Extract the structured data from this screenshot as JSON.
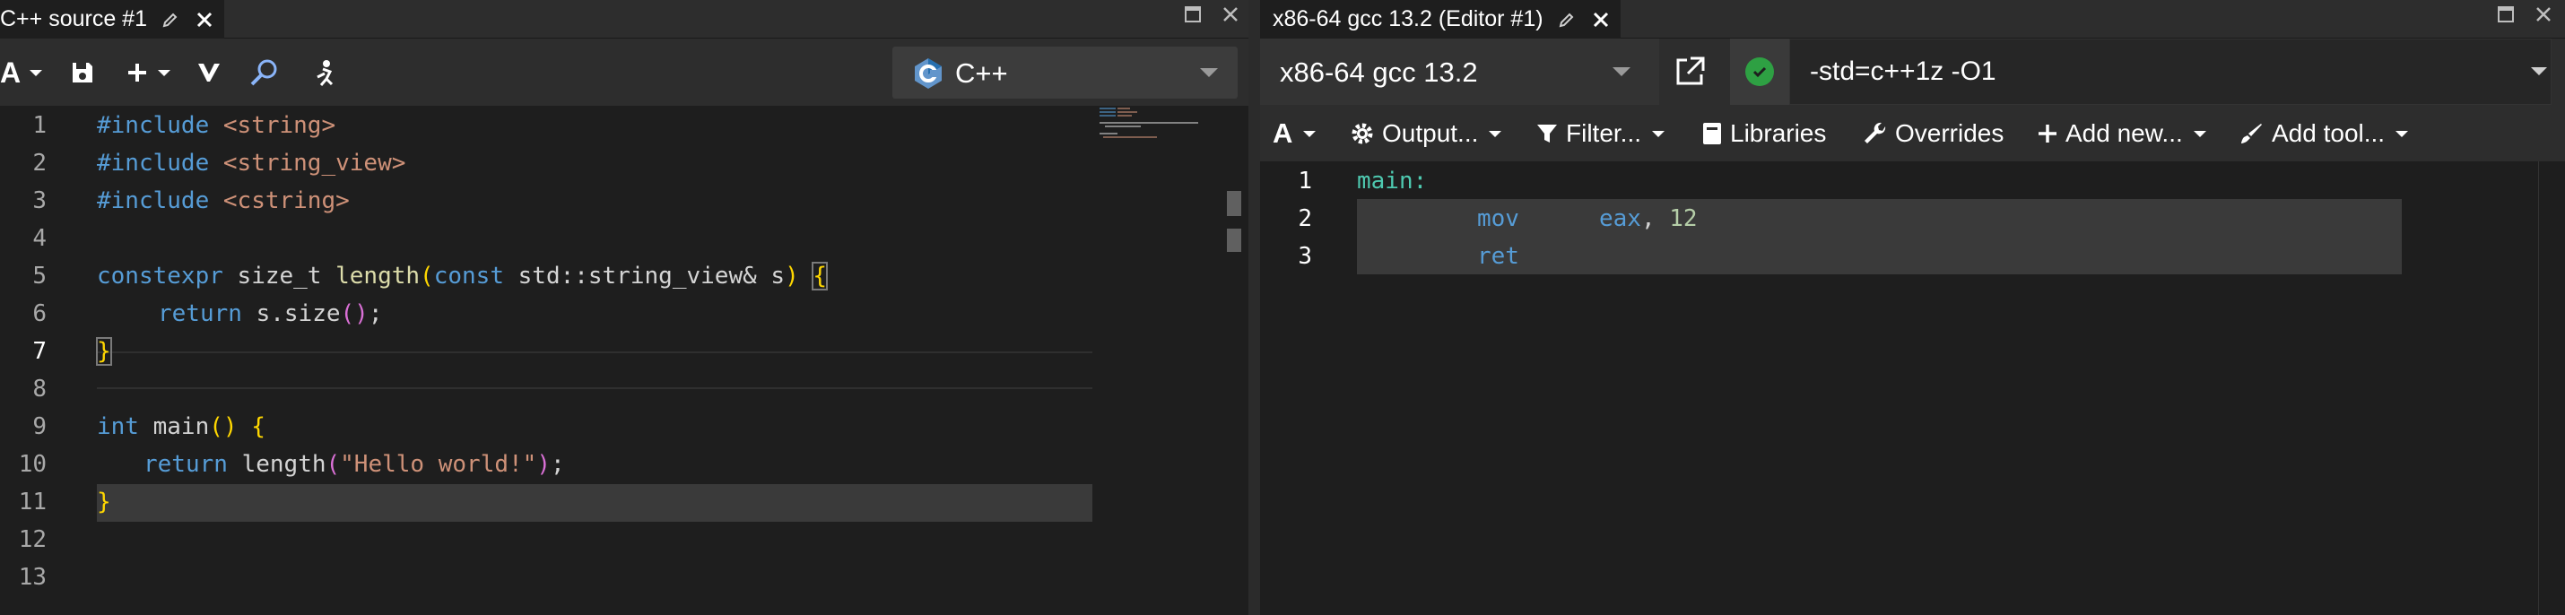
{
  "left": {
    "tab_title": "C++ source #1",
    "language": "C++",
    "lines": [
      {
        "n": "1"
      },
      {
        "n": "2"
      },
      {
        "n": "3"
      },
      {
        "n": "4"
      },
      {
        "n": "5"
      },
      {
        "n": "6"
      },
      {
        "n": "7"
      },
      {
        "n": "8"
      },
      {
        "n": "9"
      },
      {
        "n": "10"
      },
      {
        "n": "11"
      },
      {
        "n": "12"
      },
      {
        "n": "13"
      }
    ],
    "code": {
      "l1_kw": "#include",
      "l1_str": "<string>",
      "l2_kw": "#include",
      "l2_str": "<string_view>",
      "l3_kw": "#include",
      "l3_str": "<cstring>",
      "l5_kw1": "constexpr",
      "l5_type": " size_t ",
      "l5_fn": "length",
      "l5_open": "(",
      "l5_kw2": "const",
      "l5_rest": " std::string_view& s",
      "l5_close": ")",
      "l5_sp": " ",
      "l5_brace": "{",
      "l6_kw": "return",
      "l6_rest": " s.size",
      "l6_paren": "()",
      "l6_semi": ";",
      "l7_brace": "}",
      "l9_kw": "int",
      "l9_fn": " main",
      "l9_paren": "()",
      "l9_sp": " ",
      "l9_brace": "{",
      "l10_kw": "return",
      "l10_fn": " length",
      "l10_open": "(",
      "l10_str": "\"Hello world!\"",
      "l10_close": ")",
      "l10_semi": ";",
      "l11_brace": "}"
    }
  },
  "right": {
    "tab_title": "x86-64 gcc 13.2 (Editor #1)",
    "compiler": "x86-64 gcc 13.2",
    "options": "-std=c++1z -O1",
    "toolbar": {
      "output": "Output...",
      "filter": "Filter...",
      "libraries": "Libraries",
      "overrides": "Overrides",
      "add_new": "Add new...",
      "add_tool": "Add tool..."
    },
    "asm_lines": [
      {
        "n": "1"
      },
      {
        "n": "2"
      },
      {
        "n": "3"
      }
    ],
    "asm": {
      "l1": "main:",
      "l2_op": "mov",
      "l2_reg": "eax",
      "l2_comma": ", ",
      "l2_num": "12",
      "l3_op": "ret"
    }
  },
  "colors": {
    "background": "#1e1e1e",
    "toolbar": "#2d2d2d",
    "keyword": "#569cd6",
    "string": "#ce9178",
    "bracket": "#ffd700",
    "label": "#4ec9b0",
    "status_ok": "#2ea043"
  },
  "icons": [
    "font-size-icon",
    "save-icon",
    "add-icon",
    "vim-icon",
    "search-icon",
    "run-icon",
    "cpp-logo-icon",
    "edit-icon",
    "close-icon",
    "maximize-icon",
    "popout-icon",
    "check-icon",
    "gear-icon",
    "filter-icon",
    "book-icon",
    "wrench-icon",
    "plus-icon",
    "tool-icon"
  ]
}
